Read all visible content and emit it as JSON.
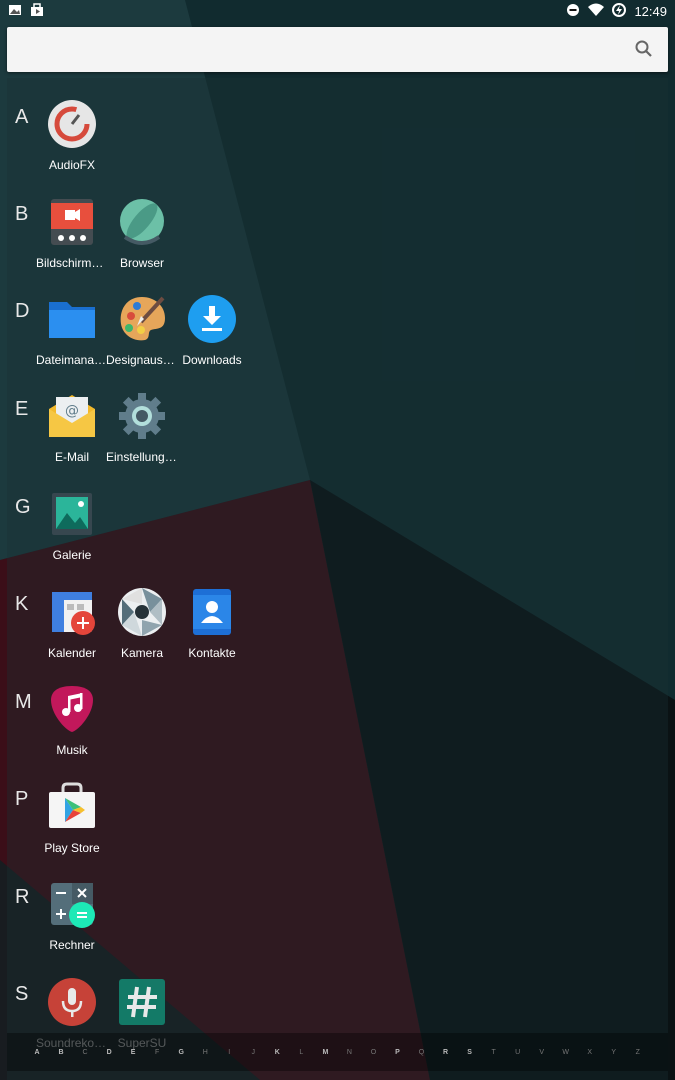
{
  "status_bar": {
    "time": "12:49",
    "left_icons": [
      "image-notification-icon",
      "shop-notification-icon"
    ],
    "right_icons": [
      "do-not-disturb-icon",
      "wifi-icon",
      "battery-charging-icon"
    ]
  },
  "search": {
    "placeholder": ""
  },
  "sections": [
    {
      "letter": "A",
      "apps": [
        {
          "label": "AudioFX",
          "icon": "audiofx-icon"
        }
      ]
    },
    {
      "letter": "B",
      "apps": [
        {
          "label": "Bildschirmau…",
          "icon": "screen-recorder-icon"
        },
        {
          "label": "Browser",
          "icon": "browser-icon"
        }
      ]
    },
    {
      "letter": "D",
      "apps": [
        {
          "label": "Dateimanager",
          "icon": "folder-icon"
        },
        {
          "label": "Designauswa…",
          "icon": "palette-icon"
        },
        {
          "label": "Downloads",
          "icon": "download-icon"
        }
      ]
    },
    {
      "letter": "E",
      "apps": [
        {
          "label": "E-Mail",
          "icon": "email-icon"
        },
        {
          "label": "Einstellungen",
          "icon": "settings-gear-icon"
        }
      ]
    },
    {
      "letter": "G",
      "apps": [
        {
          "label": "Galerie",
          "icon": "gallery-icon"
        }
      ]
    },
    {
      "letter": "K",
      "apps": [
        {
          "label": "Kalender",
          "icon": "calendar-icon"
        },
        {
          "label": "Kamera",
          "icon": "camera-shutter-icon"
        },
        {
          "label": "Kontakte",
          "icon": "contacts-icon"
        }
      ]
    },
    {
      "letter": "M",
      "apps": [
        {
          "label": "Musik",
          "icon": "music-guitar-pick-icon"
        }
      ]
    },
    {
      "letter": "P",
      "apps": [
        {
          "label": "Play Store",
          "icon": "play-store-icon"
        }
      ]
    },
    {
      "letter": "R",
      "apps": [
        {
          "label": "Rechner",
          "icon": "calculator-icon"
        }
      ]
    },
    {
      "letter": "S",
      "apps": [
        {
          "label": "Soundrekord…",
          "icon": "microphone-icon"
        },
        {
          "label": "SuperSU",
          "icon": "supersu-hash-icon"
        }
      ]
    }
  ],
  "index_bar": {
    "letters": [
      "A",
      "B",
      "C",
      "D",
      "E",
      "F",
      "G",
      "H",
      "I",
      "J",
      "K",
      "L",
      "M",
      "N",
      "O",
      "P",
      "Q",
      "R",
      "S",
      "T",
      "U",
      "V",
      "W",
      "X",
      "Y",
      "Z"
    ],
    "active": [
      "A",
      "B",
      "D",
      "E",
      "G",
      "K",
      "M",
      "P",
      "R",
      "S"
    ]
  },
  "colors": {
    "teal_bg": "#10292c",
    "red_bg": "#3a0f18",
    "dark_bg": "#0b1315"
  }
}
